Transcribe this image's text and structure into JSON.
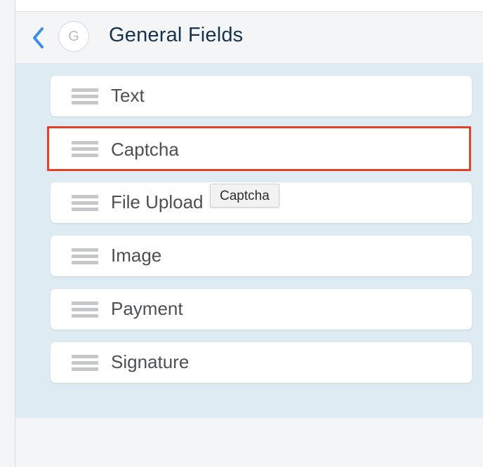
{
  "header": {
    "back_icon": "chevron-left-icon",
    "badge_letter": "G",
    "title": "General Fields"
  },
  "fields": [
    {
      "label": "Text",
      "icon": "drag-handle-icon",
      "selected": false
    },
    {
      "label": "Captcha",
      "icon": "drag-handle-icon",
      "selected": true
    },
    {
      "label": "File Upload",
      "icon": "drag-handle-icon",
      "selected": false
    },
    {
      "label": "Image",
      "icon": "drag-handle-icon",
      "selected": false
    },
    {
      "label": "Payment",
      "icon": "drag-handle-icon",
      "selected": false
    },
    {
      "label": "Signature",
      "icon": "drag-handle-icon",
      "selected": false
    }
  ],
  "tooltip": {
    "text": "Captcha"
  },
  "colors": {
    "accent": "#3a8ee6",
    "selection_border": "#e4412b",
    "panel_background": "#deebf3",
    "title_text": "#17324d"
  }
}
